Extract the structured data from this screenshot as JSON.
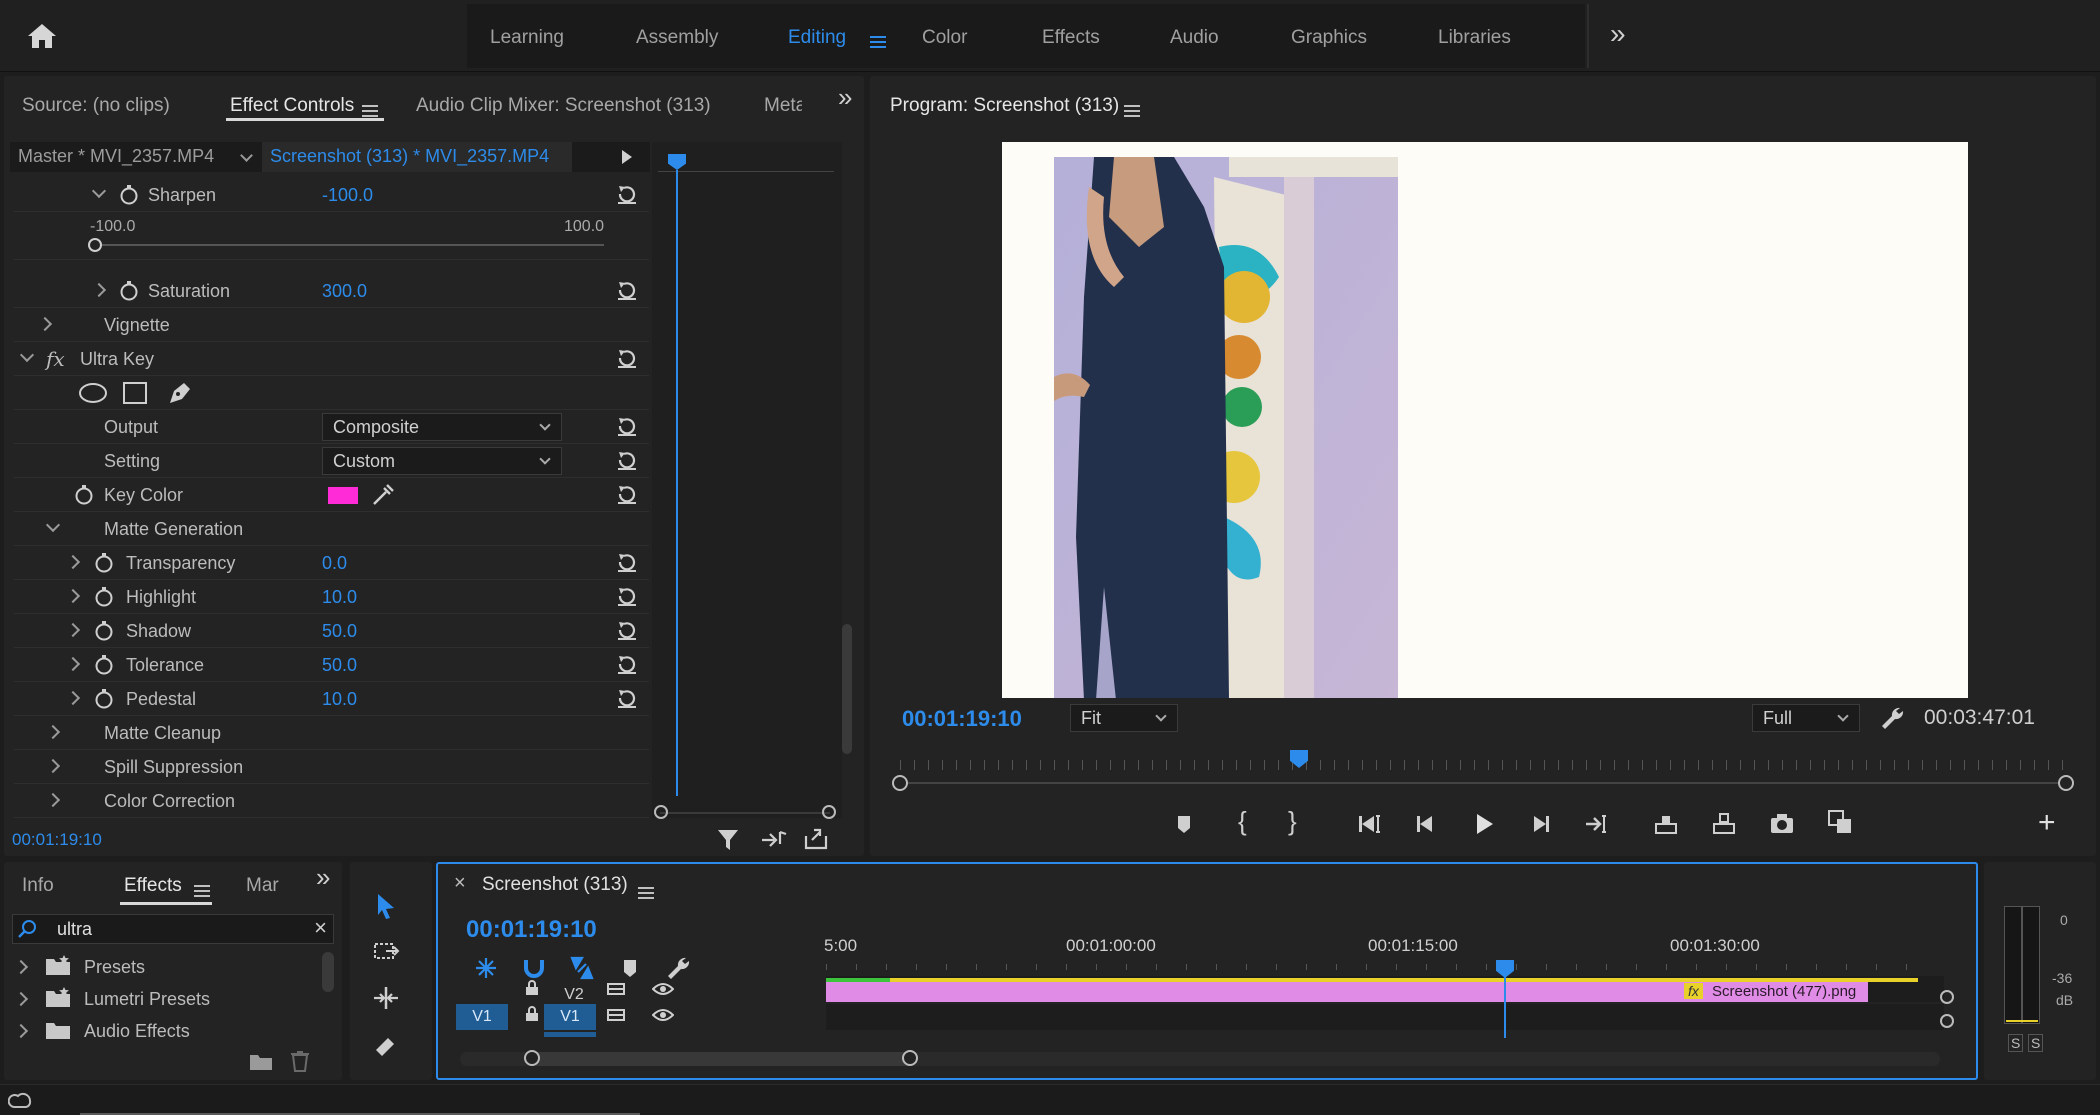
{
  "topnav": {
    "items": [
      "Learning",
      "Assembly",
      "Editing",
      "Color",
      "Effects",
      "Audio",
      "Graphics",
      "Libraries"
    ],
    "active": "Editing",
    "overflow": "»"
  },
  "source_panel": {
    "tabs": {
      "source": "Source: (no clips)",
      "effect_controls": "Effect Controls",
      "audio_mixer": "Audio Clip Mixer: Screenshot (313)",
      "meta": "Meta"
    },
    "master_label": "Master * MVI_2357.MP4",
    "clip_label": "Screenshot (313) * MVI_2357.MP4",
    "sharpen": {
      "label": "Sharpen",
      "value": "-100.0",
      "min": "-100.0",
      "max": "100.0"
    },
    "saturation": {
      "label": "Saturation",
      "value": "300.0"
    },
    "vignette": "Vignette",
    "ultra_key": {
      "fx": "fx",
      "label": "Ultra Key"
    },
    "output": {
      "label": "Output",
      "value": "Composite"
    },
    "setting": {
      "label": "Setting",
      "value": "Custom"
    },
    "key_color": {
      "label": "Key Color",
      "swatch": "#ff2bd6"
    },
    "matte_generation": "Matte Generation",
    "params": [
      {
        "label": "Transparency",
        "value": "0.0"
      },
      {
        "label": "Highlight",
        "value": "10.0"
      },
      {
        "label": "Shadow",
        "value": "50.0"
      },
      {
        "label": "Tolerance",
        "value": "50.0"
      },
      {
        "label": "Pedestal",
        "value": "10.0"
      }
    ],
    "sections": [
      "Matte Cleanup",
      "Spill Suppression",
      "Color Correction"
    ],
    "timecode": "00:01:19:10"
  },
  "program": {
    "title": "Program: Screenshot (313)",
    "timecode": "00:01:19:10",
    "fit": "Fit",
    "quality": "Full",
    "duration": "00:03:47:01"
  },
  "effects_panel": {
    "tabs": {
      "info": "Info",
      "effects": "Effects",
      "markers": "Mar"
    },
    "search_value": "ultra",
    "items": [
      "Presets",
      "Lumetri Presets",
      "Audio Effects"
    ]
  },
  "timeline": {
    "title": "Screenshot (313)",
    "timecode": "00:01:19:10",
    "ruler": [
      "5:00",
      "00:01:00:00",
      "00:01:15:00",
      "00:01:30:00"
    ],
    "tracks": {
      "v2": "V2",
      "v1_src": "V1",
      "v1": "V1"
    },
    "clip_label": "Screenshot (477).png",
    "clip_fx": "fx"
  },
  "meter": {
    "labels": [
      "0",
      "-36",
      "dB"
    ],
    "solo": [
      "S",
      "S"
    ]
  },
  "colors": {
    "accent": "#2d8ceb",
    "clip": "#e08ce6",
    "key": "#ff2bd6"
  }
}
